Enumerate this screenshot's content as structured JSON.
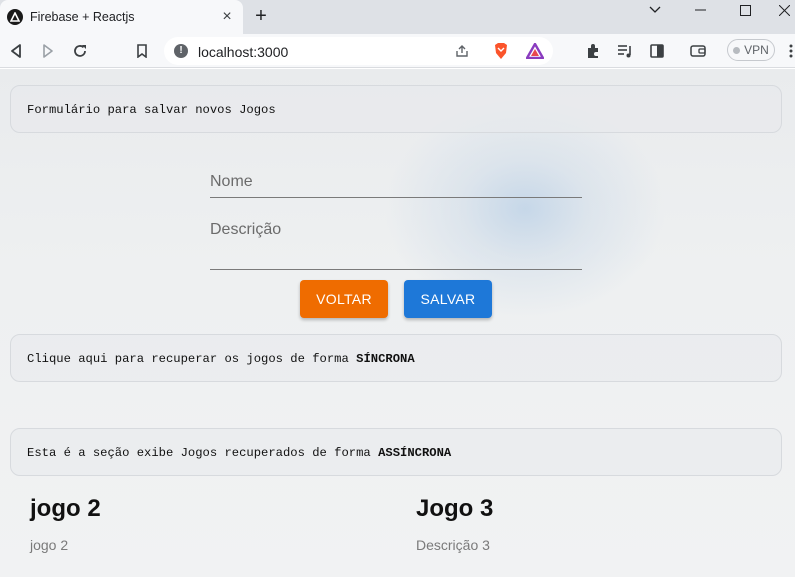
{
  "browser": {
    "tab_title": "Firebase + Reactjs",
    "url": "localhost:3000",
    "vpn_label": "VPN"
  },
  "page": {
    "form_header": "Formulário para salvar novos Jogos",
    "name_placeholder": "Nome",
    "description_placeholder": "Descrição",
    "back_button": "VOLTAR",
    "save_button": "SALVAR",
    "sync_card": {
      "text": "Clique aqui para recuperar os jogos de forma ",
      "emphasis": "SÍNCRONA"
    },
    "async_card": {
      "text": "Esta é a seção exibe Jogos recuperados de forma ",
      "emphasis": "ASSÍNCRONA"
    },
    "games": [
      {
        "title": "jogo 2",
        "description": "jogo 2"
      },
      {
        "title": "Jogo 3",
        "description": "Descrição 3"
      }
    ]
  },
  "colors": {
    "back_button": "#ef6c00",
    "save_button": "#1e78d8"
  }
}
